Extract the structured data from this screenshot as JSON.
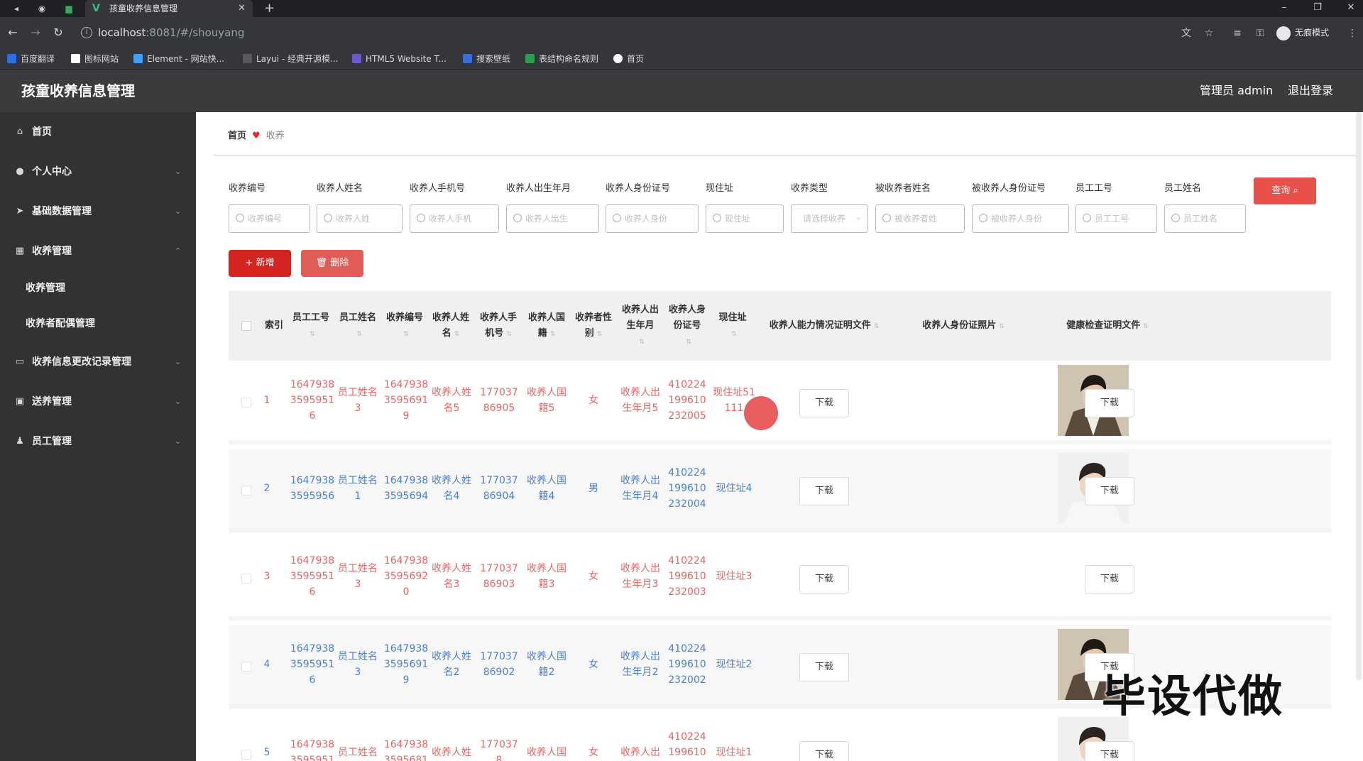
{
  "browser": {
    "tab_title": "孩童收养信息管理",
    "url_host": "localhost",
    "url_path": ":8081/#/shouyang",
    "profile_label": "无痕模式",
    "bookmarks": [
      "百度翻译",
      "图标网站",
      "Element - 网站快...",
      "Layui - 经典开源模...",
      "HTML5 Website T...",
      "搜索壁纸",
      "表结构命名规则",
      "首页"
    ]
  },
  "app": {
    "title": "孩童收养信息管理",
    "user": "管理员 admin",
    "logout": "退出登录"
  },
  "sidebar": {
    "items": [
      {
        "label": "首页",
        "icon": "home-icon"
      },
      {
        "label": "个人中心",
        "icon": "user-icon"
      },
      {
        "label": "基础数据管理",
        "icon": "send-icon"
      },
      {
        "label": "收养管理",
        "icon": "grid-icon"
      },
      {
        "label": "收养信息更改记录管理",
        "icon": "message-icon"
      },
      {
        "label": "送养管理",
        "icon": "picture-icon"
      },
      {
        "label": "员工管理",
        "icon": "person-icon"
      }
    ],
    "subitems": [
      "收养管理",
      "收养者配偶管理"
    ]
  },
  "breadcrumb": {
    "home": "首页",
    "current": "收养"
  },
  "filters": [
    {
      "label": "收养编号",
      "placeholder": "收养编号"
    },
    {
      "label": "收养人姓名",
      "placeholder": "收养人姓"
    },
    {
      "label": "收养人手机号",
      "placeholder": "收养人手机"
    },
    {
      "label": "收养人出生年月",
      "placeholder": "收养人出生"
    },
    {
      "label": "收养人身份证号",
      "placeholder": "收养人身份"
    },
    {
      "label": "现住址",
      "placeholder": "现住址"
    },
    {
      "label": "收养类型",
      "placeholder": "请选择收养"
    },
    {
      "label": "被收养者姓名",
      "placeholder": "被收养者姓"
    },
    {
      "label": "被收养人身份证号",
      "placeholder": "被收养人身份"
    },
    {
      "label": "员工工号",
      "placeholder": "员工工号"
    },
    {
      "label": "员工姓名",
      "placeholder": "员工姓名"
    }
  ],
  "buttons": {
    "query": "查询",
    "add": "新增",
    "delete": "删除",
    "download": "下载"
  },
  "table": {
    "headers": [
      "索引",
      "员工工号",
      "员工姓名",
      "收养编号",
      "收养人姓名",
      "收养人手机号",
      "收养人国籍",
      "收养者性别",
      "收养人出生年月",
      "收养人身份证号",
      "现住址",
      "收养人能力情况证明文件",
      "收养人身份证照片",
      "健康检查证明文件"
    ],
    "rows": [
      {
        "index": "1",
        "emp_no": "16479383595951 6",
        "emp_name": "员工姓名3",
        "adopt_no": "16479383595691 9",
        "adopter": "收养人姓名5",
        "phone": "17703786905",
        "nationality": "收养人国籍5",
        "gender": "女",
        "birth": "收养人出生年月5",
        "id_no": "410224199610232005",
        "address": "现住址51111",
        "photo": "photo-jacket"
      },
      {
        "index": "2",
        "emp_no": "16479383595956",
        "emp_name": "员工姓名1",
        "adopt_no": "16479383595694",
        "adopter": "收养人姓名4",
        "phone": "17703786904",
        "nationality": "收养人国籍4",
        "gender": "男",
        "birth": "收养人出生年月4",
        "id_no": "410224199610232004",
        "address": "现住址4",
        "photo": "photo-white"
      },
      {
        "index": "3",
        "emp_no": "16479383595951 6",
        "emp_name": "员工姓名3",
        "adopt_no": "16479383595692 0",
        "adopter": "收养人姓名3",
        "phone": "17703786903",
        "nationality": "收养人国籍3",
        "gender": "女",
        "birth": "收养人出生年月3",
        "id_no": "410224199610232003",
        "address": "现住址3",
        "photo": ""
      },
      {
        "index": "4",
        "emp_no": "16479383595951 6",
        "emp_name": "员工姓名3",
        "adopt_no": "16479383595691 9",
        "adopter": "收养人姓名2",
        "phone": "17703786902",
        "nationality": "收养人国籍2",
        "gender": "女",
        "birth": "收养人出生年月2",
        "id_no": "410224199610232002",
        "address": "现住址2",
        "photo": "photo-jacket"
      },
      {
        "index": "5",
        "emp_no": "16479383595951",
        "emp_name": "员工姓名",
        "adopt_no": "16479383595681",
        "adopter": "收养人姓",
        "phone": "1770378",
        "nationality": "收养人国",
        "gender": "女",
        "birth": "收养人出",
        "id_no": "41022419961023",
        "address": "现住址1",
        "photo": "photo-white"
      }
    ]
  },
  "watermark": "毕设代做",
  "colors": {
    "accent": "#e8504a",
    "danger": "#d4241f",
    "row_red": "#e86464",
    "row_blue": "#4a7fd4",
    "sidebar_bg": "#323232",
    "header_bg": "#3a3b3c"
  }
}
